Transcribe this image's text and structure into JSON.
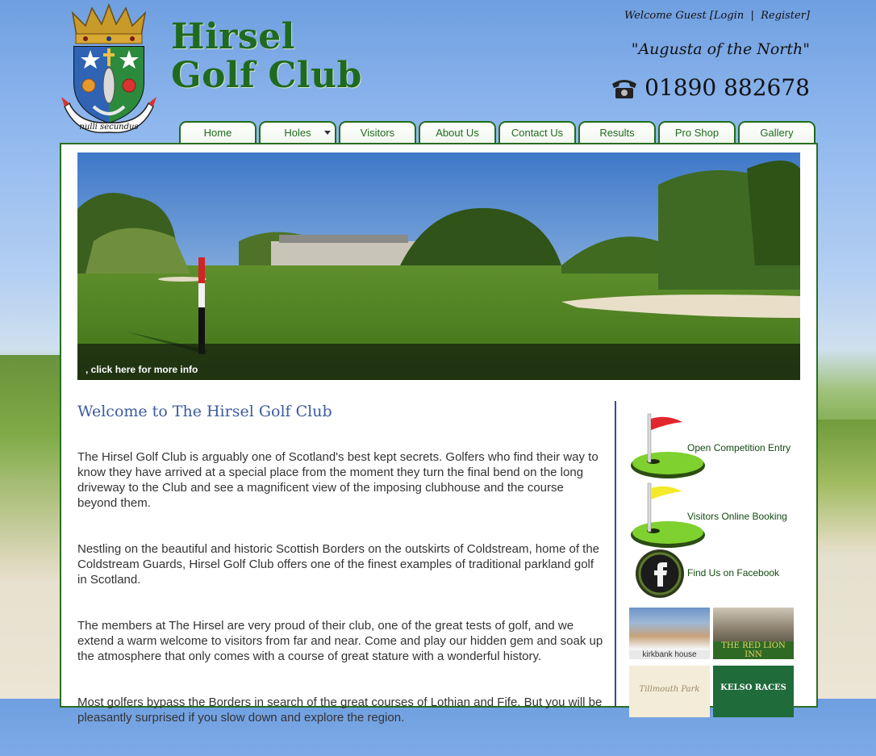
{
  "header": {
    "logo_line1": "Hirsel",
    "logo_line2": "Golf Club",
    "crest_motto": "nulli secundus",
    "welcome_text": "Welcome Guest",
    "login_label": "[Login",
    "separator": "|",
    "register_label": "Register]",
    "tagline": "\"Augusta of the North\"",
    "phone": "01890 882678"
  },
  "nav": {
    "tabs": [
      {
        "label": "Home"
      },
      {
        "label": "Holes"
      },
      {
        "label": "Visitors"
      },
      {
        "label": "About Us"
      },
      {
        "label": "Contact Us"
      },
      {
        "label": "Results"
      },
      {
        "label": "Pro Shop"
      },
      {
        "label": "Gallery"
      }
    ]
  },
  "hero": {
    "caption": ", click here for more info"
  },
  "content": {
    "title": "Welcome to The Hirsel Golf Club",
    "paragraphs": [
      "The Hirsel Golf Club is arguably one of Scotland's best kept secrets. Golfers who find their way to know they have arrived at a special place from the moment they turn the final bend on the long driveway to the Club and see a magnificent view of the imposing clubhouse and the course beyond them.",
      "Nestling on the beautiful and historic Scottish Borders on the outskirts of Coldstream, home of the Coldstream Guards, Hirsel Golf Club offers one of the finest examples of traditional parkland golf in Scotland.",
      "The members at The Hirsel are very proud of their club, one of the great tests of golf, and we extend a warm welcome to visitors from far and near. Come and play our hidden gem and soak up the atmosphere that only comes with a course of great stature with a wonderful history.",
      "Most golfers bypass the Borders in search of the great courses of Lothian and Fife. But you will be pleasantly surprised if you slow down and explore the region."
    ]
  },
  "sidebar": {
    "items": [
      {
        "label": "Open Competition Entry",
        "flag_color": "#e3252d"
      },
      {
        "label": "Visitors Online Booking",
        "flag_color": "#f2ea2a"
      },
      {
        "label": "Find Us on Facebook"
      }
    ],
    "sponsors": [
      {
        "label": "kirkbank house"
      },
      {
        "label": "THE RED LION INN"
      },
      {
        "label": "Tillmouth Park"
      },
      {
        "label": "KELSO RACES"
      }
    ]
  },
  "colors": {
    "brand_green": "#1f6a1f",
    "title_blue": "#3b5b9d",
    "divider_blue": "#2d4c9a"
  }
}
